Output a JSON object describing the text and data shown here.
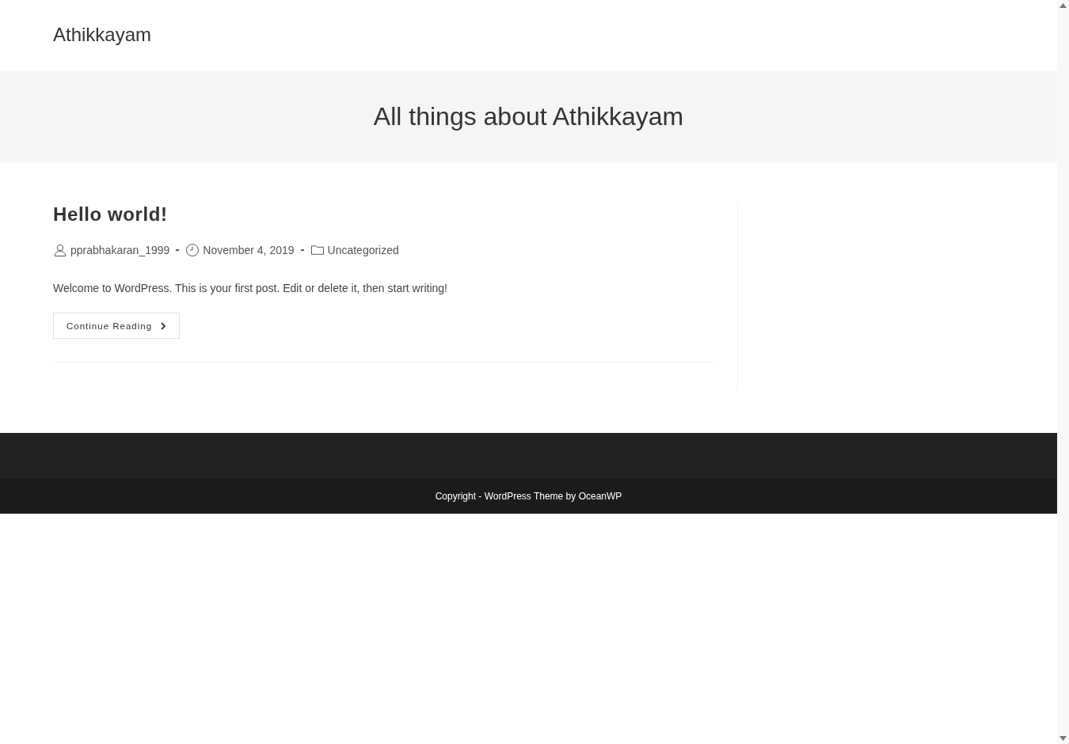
{
  "site": {
    "title": "Athikkayam"
  },
  "page_header": {
    "title": "All things about Athikkayam"
  },
  "posts": [
    {
      "title": "Hello world!",
      "meta": [
        {
          "kind": "author",
          "text": "pprabhakaran_1999"
        },
        {
          "kind": "date",
          "text": "November 4, 2019"
        },
        {
          "kind": "category",
          "text": "Uncategorized"
        }
      ],
      "excerpt": "Welcome to WordPress. This is your first post. Edit or delete it, then start writing!",
      "button": "Continue Reading"
    }
  ],
  "footer": {
    "copyright": "Copyright - WordPress Theme by OceanWP"
  }
}
